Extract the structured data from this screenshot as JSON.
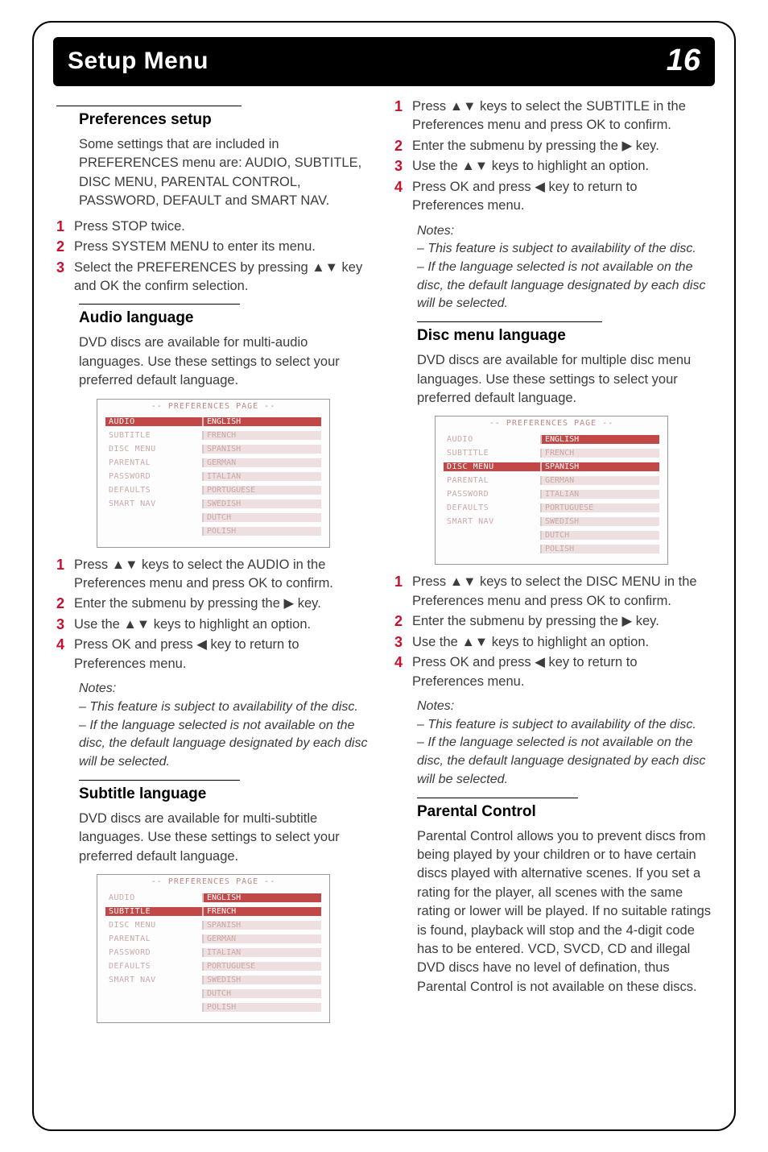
{
  "header": {
    "title": "Setup Menu",
    "page": "16"
  },
  "glyph": {
    "updown": "▲▼",
    "right": "▶",
    "left": "◀"
  },
  "pref": {
    "heading": "Preferences setup",
    "intro": "Some settings that are included in PREFERENCES menu are: AUDIO, SUBTITLE, DISC MENU, PARENTAL CONTROL, PASSWORD, DEFAULT and SMART NAV.",
    "steps": [
      "Press STOP twice.",
      "Press SYSTEM MENU to enter its menu.",
      "Select the PREFERENCES by pressing ▲▼ key and OK the confirm selection."
    ]
  },
  "audio": {
    "heading": "Audio language",
    "intro": "DVD discs are available for multi-audio languages. Use these settings to select your preferred default language.",
    "steps": [
      "Press ▲▼ keys to select the AUDIO in the Preferences menu and press OK to confirm.",
      "Enter the submenu by pressing the ▶ key.",
      "Use the ▲▼ keys to highlight an option.",
      "Press OK and press ◀ key to return to Preferences menu."
    ],
    "notes_heading": "Notes:",
    "notes": [
      "–   This feature is subject to availability of the disc.",
      "–   If the language selected is not available on the disc, the default language designated by each disc will be selected."
    ]
  },
  "subtitle": {
    "heading": "Subtitle language",
    "intro": "DVD discs are available for multi-subtitle languages. Use these settings to select your preferred default language.",
    "steps": [
      "Press ▲▼ keys to select the SUBTITLE in the Preferences menu and press OK to confirm.",
      "Enter the submenu by pressing the ▶ key.",
      "Use the ▲▼ keys to highlight an option.",
      "Press OK and press ◀ key to return to Preferences menu."
    ],
    "notes_heading": "Notes:",
    "notes": [
      "–   This feature is subject to availability of the disc.",
      "–   If the language selected is not available on the disc, the default language designated by each disc will be selected."
    ]
  },
  "discmenu": {
    "heading": "Disc menu language",
    "intro": "DVD discs are available for multiple disc menu languages. Use these settings to select your preferred default language.",
    "steps": [
      "Press ▲▼ keys to select the DISC MENU in the Preferences menu and press OK to confirm.",
      "Enter the submenu by pressing the ▶ key.",
      "Use the ▲▼ keys to highlight an option.",
      "Press OK and press ◀ key to return to Preferences menu."
    ],
    "notes_heading": "Notes:",
    "notes": [
      "–   This feature is subject to availability of the disc.",
      "–   If the language selected is not available on the disc, the default language designated by each disc will be selected."
    ]
  },
  "parental": {
    "heading": "Parental Control",
    "body": "Parental Control allows you to prevent discs from being played by your children or to have certain discs played with alternative scenes. If you set a rating for the player, all scenes with the same rating or lower will be played. If no suitable ratings is found, playback will stop and the 4-digit code has to be entered. VCD, SVCD, CD and illegal DVD discs have no level of defination, thus Parental Control is not available on these discs."
  },
  "sc": {
    "title": "-- PREFERENCES PAGE --",
    "left": [
      "AUDIO",
      "SUBTITLE",
      "DISC MENU",
      "PARENTAL",
      "PASSWORD",
      "DEFAULTS",
      "SMART NAV"
    ],
    "right": [
      "ENGLISH",
      "FRENCH",
      "SPANISH",
      "GERMAN",
      "ITALIAN",
      "PORTUGUESE",
      "SWEDISH",
      "DUTCH",
      "POLISH"
    ]
  }
}
